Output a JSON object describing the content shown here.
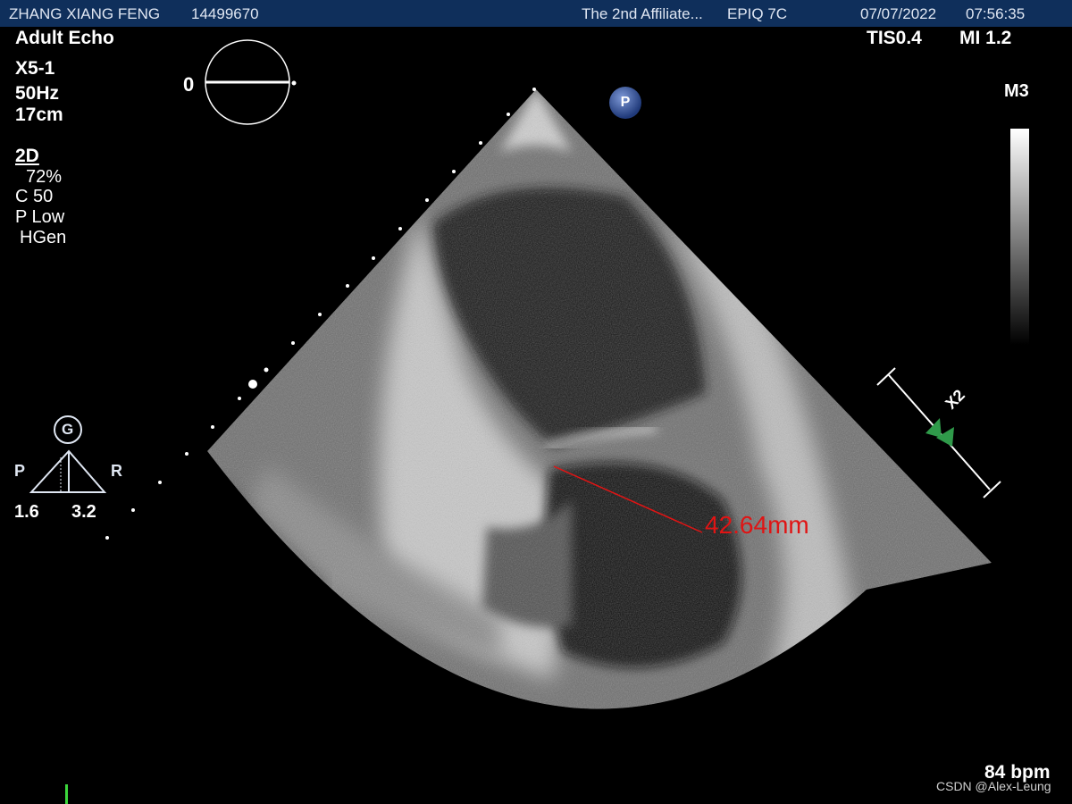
{
  "header": {
    "patient_name": "ZHANG XIANG FENG",
    "patient_id": "14499670",
    "institution": "The 2nd Affiliate...",
    "system": "EPIQ 7C",
    "date": "07/07/2022",
    "time": "07:56:35"
  },
  "preset": {
    "exam": "Adult Echo",
    "probe": "X5-1",
    "frame_rate": "50Hz",
    "depth": "17cm"
  },
  "imaging": {
    "mode": "2D",
    "gain": "72%",
    "compression": "C 50",
    "power": "P Low",
    "harmonics": "HGen"
  },
  "safety": {
    "tis": "TIS0.4",
    "mi": "MI 1.2"
  },
  "rotation": {
    "angle_label": "0"
  },
  "map": {
    "label": "M3"
  },
  "p_badge": "P",
  "xplane": {
    "label": "X2"
  },
  "orientation": {
    "g_label": "G",
    "left_letter": "P",
    "right_letter": "R",
    "left_value": "1.6",
    "right_value": "3.2"
  },
  "measurement": {
    "value": "42.64mm",
    "color": "#e01414"
  },
  "heart_rate": "84 bpm",
  "watermark": "CSDN @Alex-Leung",
  "colors": {
    "header_bg": "#0f2f5b",
    "marker_green": "#2f9a4a",
    "ecg_green": "#3cd63c"
  }
}
